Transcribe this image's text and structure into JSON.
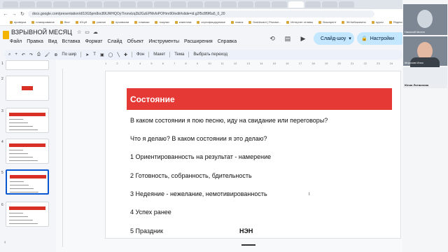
{
  "browser": {
    "tabs": [
      "",
      "",
      "",
      "",
      "",
      "",
      "",
      "",
      "",
      "",
      "",
      "",
      "",
      "",
      "",
      "",
      "",
      "",
      "",
      "",
      ""
    ],
    "url": "docs.google.com/presentation/d/10G5pm8oc89UWHQOy7Ironvlzq2b2GzEPMvfoPOHmr90/edit#slide=id.g2f5c8f9f6a5_0_20",
    "bookmarks": [
      "проверка",
      "планирование",
      "блог",
      "Ютуб",
      "разное",
      "прозвоспи",
      "планики",
      "покупки",
      "клиентам",
      "сертифицируемые",
      "ламок",
      "Dashboard | Рекоми...",
      "Интернет отливы",
      "бизопрент",
      "Эй Кибикапаты",
      "курсы",
      "Яндекс.Деньги"
    ]
  },
  "app": {
    "doc_title": "ВЗРЫВНОЙ МЕСЯЦ",
    "menu": [
      "Файл",
      "Правка",
      "Вид",
      "Вставка",
      "Формат",
      "Слайд",
      "Объект",
      "Инструменты",
      "Расширения",
      "Справка"
    ],
    "slideshow_label": "Слайд-шоу",
    "settings_label": "Настройки",
    "toolbar": {
      "zoom": "По шир",
      "bg": "Фон",
      "layout": "Макет",
      "theme": "Тема",
      "transition": "Выбрать переход"
    }
  },
  "ruler": [
    "1",
    "2",
    "3",
    "4",
    "5",
    "6",
    "7",
    "8",
    "9",
    "10",
    "11",
    "12",
    "13",
    "14",
    "15",
    "16",
    "17",
    "18",
    "19",
    "20",
    "21",
    "22",
    "23",
    "24",
    "25"
  ],
  "thumbnails": [
    "1",
    "2",
    "3",
    "4",
    "5",
    "6"
  ],
  "slide": {
    "title": "Состояние",
    "lines": [
      "В каком состоянии я пою песню, иду на свидание или переговоры?",
      "Что я делаю? В каком состоянии я это делаю?",
      "1 Ориентированность на результат - намерение",
      "2 Готовность, собранность, бдительность",
      "3 Недеяние - нежелание, немотивированность",
      "4 Успех ранее",
      "5 Праздник"
    ],
    "extra": "НЭН"
  },
  "video": {
    "participants": [
      "Николай Митин",
      "Морозов Илья",
      "Юлия Литвинова"
    ]
  },
  "colors": {
    "slide_header": "#e53935",
    "accent": "#0b57d0",
    "button_bg": "#c2e7ff"
  }
}
